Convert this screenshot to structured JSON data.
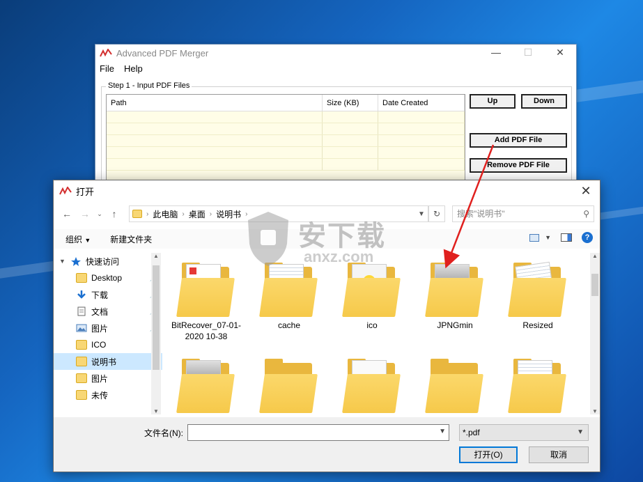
{
  "merger": {
    "title": "Advanced PDF Merger",
    "menu": [
      "File",
      "Help"
    ],
    "group_label": "Step 1 - Input PDF Files",
    "columns": [
      "Path",
      "Size (KB)",
      "Date Created"
    ],
    "buttons": {
      "up": "Up",
      "down": "Down",
      "add": "Add PDF File",
      "remove": "Remove PDF File"
    }
  },
  "dialog": {
    "title": "打开",
    "breadcrumbs": [
      "此电脑",
      "桌面",
      "说明书"
    ],
    "search_placeholder": "搜索\"说明书\"",
    "toolbar": {
      "organize": "组织",
      "new_folder": "新建文件夹"
    },
    "tree": [
      {
        "label": "快速访问",
        "icon": "star-icon",
        "top": true,
        "pinned": false,
        "selected": false
      },
      {
        "label": "Desktop",
        "icon": "folder-icon",
        "top": false,
        "pinned": true,
        "selected": false
      },
      {
        "label": "下载",
        "icon": "download-icon",
        "top": false,
        "pinned": true,
        "selected": false
      },
      {
        "label": "文档",
        "icon": "document-icon",
        "top": false,
        "pinned": true,
        "selected": false
      },
      {
        "label": "图片",
        "icon": "picture-icon",
        "top": false,
        "pinned": true,
        "selected": false
      },
      {
        "label": "ICO",
        "icon": "folder-icon",
        "top": false,
        "pinned": false,
        "selected": false
      },
      {
        "label": "说明书",
        "icon": "folder-icon",
        "top": false,
        "pinned": false,
        "selected": true
      },
      {
        "label": "图片",
        "icon": "folder-icon",
        "top": false,
        "pinned": false,
        "selected": false
      },
      {
        "label": "未传",
        "icon": "folder-icon",
        "top": false,
        "pinned": false,
        "selected": false
      }
    ],
    "files": [
      {
        "name": "BitRecover_07-01-2020 10-38",
        "kind": "folder-pdf"
      },
      {
        "name": "cache",
        "kind": "folder-doc"
      },
      {
        "name": "ico",
        "kind": "folder-img"
      },
      {
        "name": "JPNGmin",
        "kind": "folder-photo"
      },
      {
        "name": "Resized",
        "kind": "folder-doc2"
      },
      {
        "name": "",
        "kind": "folder-photo"
      },
      {
        "name": "",
        "kind": "folder"
      },
      {
        "name": "",
        "kind": "folder-paper"
      },
      {
        "name": "",
        "kind": "folder"
      },
      {
        "name": "",
        "kind": "folder-doc"
      }
    ],
    "filename_label": "文件名(N):",
    "filename_value": "",
    "filetype": "*.pdf",
    "open_button": "打开(O)",
    "cancel_button": "取消"
  },
  "watermark": {
    "text_cn": "安下载",
    "text_en": "anxz.com"
  },
  "colors": {
    "accent": "#0078d7",
    "selection": "#cce8ff",
    "folder": "#f8d775",
    "arrow": "#e0201e"
  }
}
